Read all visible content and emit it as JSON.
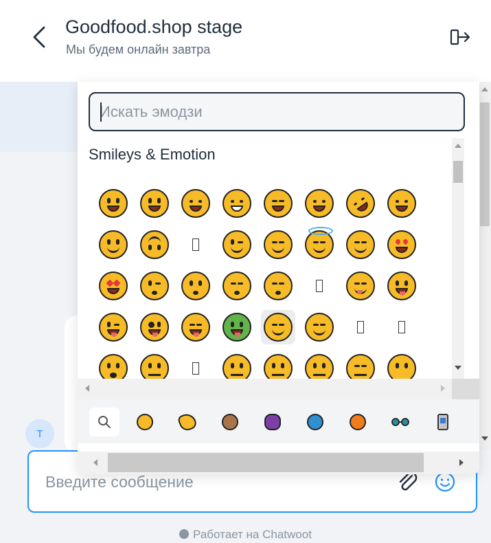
{
  "header": {
    "title": "Goodfood.shop stage",
    "subtitle": "Мы будем онлайн завтра"
  },
  "messages": {
    "avatar_initial": "T"
  },
  "composer": {
    "placeholder": "Введите сообщение"
  },
  "branding": {
    "text": "Работает на Chatwoot"
  },
  "emoji_picker": {
    "search_placeholder": "Искать эмодзи",
    "category_title": "Smileys & Emotion",
    "categories": [
      "search-icon",
      "smileys-emotion-icon",
      "people-body-icon",
      "animals-nature-icon",
      "food-drink-icon",
      "travel-places-icon",
      "activities-icon",
      "objects-icon",
      "symbols-icon"
    ],
    "highlighted": "smiling-face-with-open-hands",
    "rows": [
      [
        "grinning-face",
        "grinning-face-with-big-eyes",
        "grinning-face-with-smiling-eyes",
        "beaming-face",
        "grinning-squinting-face",
        "grinning-face-with-sweat",
        "rolling-on-floor-laughing",
        "face-with-tears-of-joy"
      ],
      [
        "slightly-smiling-face",
        "upside-down-face",
        "unsupported-glyph",
        "winking-face",
        "smiling-face-with-smiling-eyes",
        "smiling-face-with-halo",
        "smiling-face-with-hearts",
        "smiling-face-with-heart-eyes"
      ],
      [
        "star-struck",
        "face-blowing-a-kiss",
        "kissing-face",
        "kissing-face-with-closed-eyes",
        "kissing-face-with-smiling-eyes",
        "unsupported-glyph",
        "face-savoring-food",
        "face-with-tongue"
      ],
      [
        "winking-face-with-tongue",
        "zany-face",
        "squinting-face-with-tongue",
        "money-mouth-face",
        "smiling-face-with-open-hands",
        "face-with-hand-over-mouth",
        "unsupported-glyph",
        "unsupported-glyph"
      ],
      [
        "face-with-open-eyes-and-hand",
        "thinking-face",
        "unsupported-glyph",
        "zipper-mouth-face",
        "face-with-raised-eyebrow",
        "neutral-face",
        "expressionless-face",
        "face-without-mouth"
      ]
    ]
  },
  "colors": {
    "accent": "#1f93ff",
    "emoji_yellow": "#f7bb27",
    "text": "#1f2d3d",
    "muted": "#8a96a3"
  }
}
